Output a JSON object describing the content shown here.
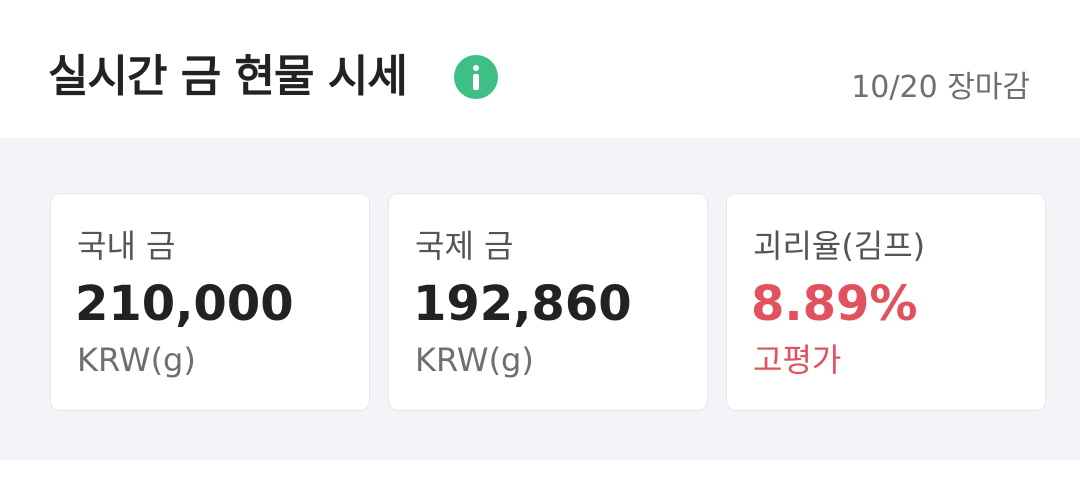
{
  "header": {
    "title": "실시간 금 현물 시세",
    "info_icon": "info-icon",
    "date": "10/20 장마감"
  },
  "cards": [
    {
      "label": "국내 금",
      "value": "210,000",
      "unit": "KRW(g)"
    },
    {
      "label": "국제 금",
      "value": "192,860",
      "unit": "KRW(g)"
    },
    {
      "label": "괴리율(김프)",
      "value": "8.89%",
      "unit": "고평가"
    }
  ],
  "colors": {
    "accent_green": "#3dbf85",
    "premium_red": "#e2515e",
    "panel_bg": "#f2f4f8"
  }
}
